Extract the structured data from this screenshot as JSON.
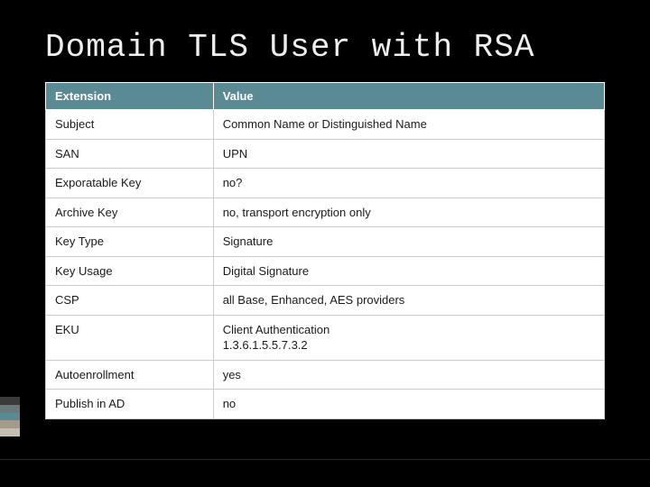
{
  "title": "Domain TLS User with RSA",
  "headers": {
    "col1": "Extension",
    "col2": "Value"
  },
  "rows": [
    {
      "ext": "Subject",
      "val": "Common Name or Distinguished Name"
    },
    {
      "ext": "SAN",
      "val": "UPN"
    },
    {
      "ext": "Exporatable Key",
      "val": "no?"
    },
    {
      "ext": "Archive Key",
      "val": "no, transport encryption only"
    },
    {
      "ext": "Key Type",
      "val": "Signature"
    },
    {
      "ext": "Key Usage",
      "val": "Digital Signature"
    },
    {
      "ext": "CSP",
      "val": "all Base, Enhanced, AES providers"
    },
    {
      "ext": "EKU",
      "val": "Client Authentication\n1.3.6.1.5.5.7.3.2"
    },
    {
      "ext": "Autoenrollment",
      "val": "yes"
    },
    {
      "ext": "Publish in AD",
      "val": "no"
    }
  ]
}
